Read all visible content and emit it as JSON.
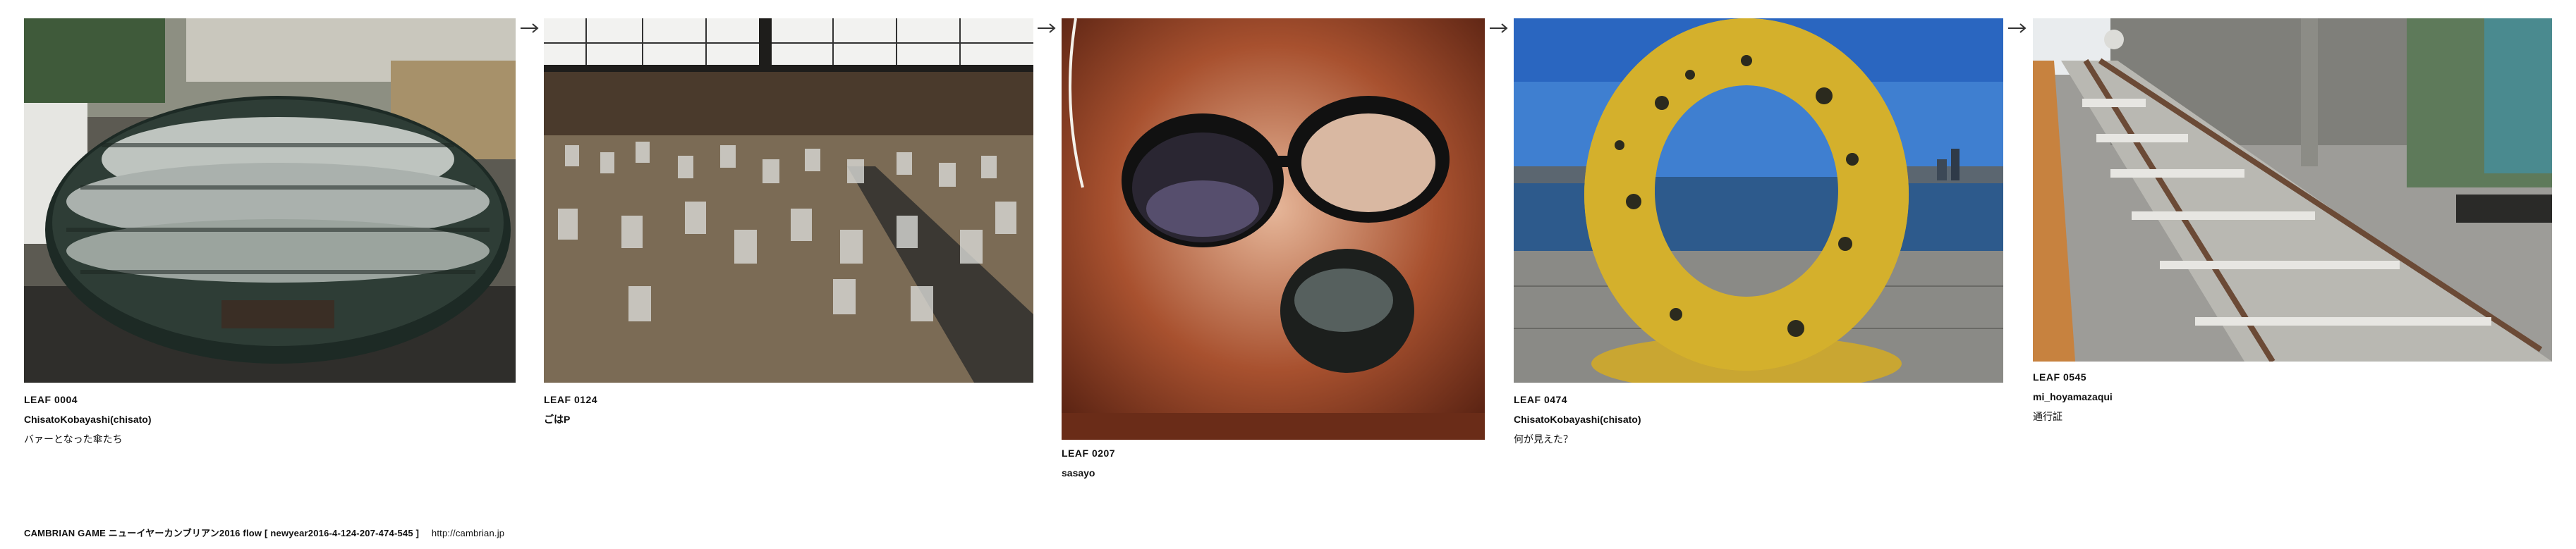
{
  "cards": [
    {
      "leaf": "LEAF 0004",
      "author": "ChisatoKobayashi(chisato)",
      "caption": "バァーとなった傘たち"
    },
    {
      "leaf": "LEAF 0124",
      "author": "ごはP",
      "caption": ""
    },
    {
      "leaf": "LEAF 0207",
      "author": "sasayo",
      "caption": ""
    },
    {
      "leaf": "LEAF 0474",
      "author": "ChisatoKobayashi(chisato)",
      "caption": "何が見えた？"
    },
    {
      "leaf": "LEAF 0545",
      "author": "mi_hoyamazaqui",
      "caption": "通行証"
    }
  ],
  "arrows": [
    "→",
    "→",
    "→",
    "→"
  ],
  "footer": {
    "title": "CAMBRIAN GAME ニューイヤーカンブリアン2016 flow [ newyear2016-4-124-207-474-545 ]",
    "url": "http://cambrian.jp"
  },
  "colors": {
    "text": "#111111",
    "arrow": "#333333"
  }
}
